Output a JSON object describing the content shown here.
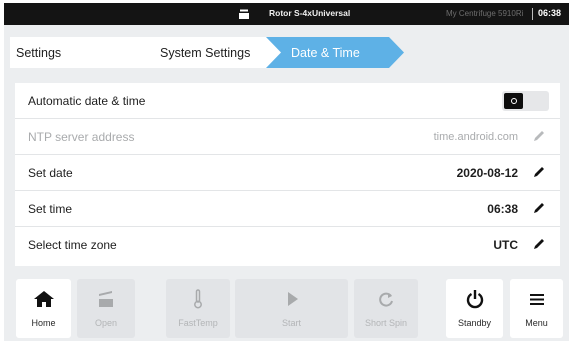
{
  "status_bar": {
    "rotor_icon": "rotor-icon",
    "rotor_label": "Rotor S-4xUniversal",
    "device_label": "My Centrifuge 5910Ri",
    "time": "06:38"
  },
  "breadcrumb": {
    "items": [
      {
        "label": "Settings"
      },
      {
        "label": "System Settings"
      },
      {
        "label": "Date & Time",
        "active": true
      }
    ],
    "active_color": "#5eb1e6"
  },
  "settings": {
    "rows": [
      {
        "label": "Automatic date & time",
        "control": "toggle",
        "toggle_state": "off"
      },
      {
        "label": "NTP server address",
        "value": "time.android.com",
        "disabled": true,
        "icon": "pencil-icon"
      },
      {
        "label": "Set date",
        "value": "2020-08-12",
        "icon": "pencil-icon"
      },
      {
        "label": "Set time",
        "value": "06:38",
        "icon": "pencil-icon"
      },
      {
        "label": "Select time zone",
        "value": "UTC",
        "icon": "pencil-icon"
      }
    ]
  },
  "toolbar": {
    "buttons": [
      {
        "label": "Home",
        "icon": "home-icon",
        "enabled": true
      },
      {
        "label": "Open",
        "icon": "lid-open-icon",
        "enabled": false
      },
      {
        "label": "FastTemp",
        "icon": "thermometer-icon",
        "enabled": false
      },
      {
        "label": "Start",
        "icon": "play-icon",
        "enabled": false
      },
      {
        "label": "Short Spin",
        "icon": "refresh-icon",
        "enabled": false
      },
      {
        "label": "Standby",
        "icon": "power-icon",
        "enabled": true
      },
      {
        "label": "Menu",
        "icon": "menu-icon",
        "enabled": true
      }
    ]
  }
}
